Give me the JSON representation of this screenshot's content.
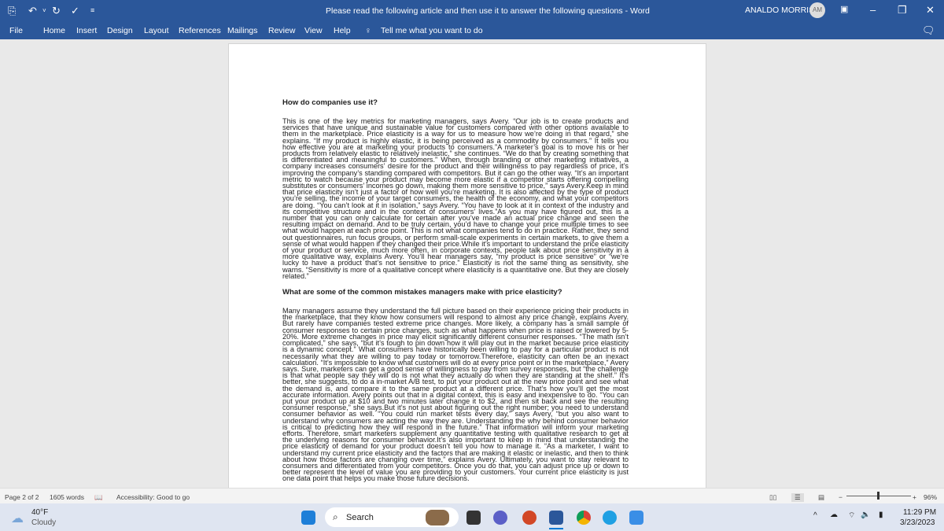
{
  "titlebar": {
    "title": "Please read the following article and then use it to answer the following questions  -  Word",
    "user": "ANALDO MORRIS",
    "avatar": "AM"
  },
  "tabs": [
    "File",
    "Home",
    "Insert",
    "Design",
    "Layout",
    "References",
    "Mailings",
    "Review",
    "View",
    "Help"
  ],
  "tell_me": "Tell me what you want to do",
  "doc": {
    "heading1": "How do companies use it?",
    "para1": "This is one of the key metrics for marketing managers, says Avery. “Our job is to create products and services that have unique and sustainable value for customers compared with other options available to them in the marketplace. Price elasticity is a way for us to measure how we’re doing in that regard,” she explains. “If my product is highly elastic, it is being perceived as a commodity by consumers.” It tells you how effective you are at marketing your products to consumers.”A marketer’s goal is to move his or her products from relatively elastic to relatively inelastic,” she continues. “We do that by creating something that is differentiated and meaningful to customers.” When, through branding or other marketing initiatives, a company increases consumers’ desire for the product and their willingness to pay regardless of price, it’s improving the company’s standing compared with competitors. But it can go the other way. “It’s an important metric to watch because your product may become more elastic if a competitor starts offering compelling substitutes or consumers’ incomes go down, making them more sensitive to price,” says Avery.Keep in mind that price elasticity isn’t just a factor of how well you’re marketing. It is also affected by the type of product you’re selling, the income of your target consumers, the health of the economy, and what your competitors are doing. “You can’t look at it in isolation,” says Avery. “You have to look at it in context of the industry and its competitive structure and in the context of consumers’ lives.”As you may have figured out, this is a number that you can only calculate for certain after you’ve made an actual price change and seen the resulting impact on demand. And to be truly certain, you’d have to change your price multiple times to see what would happen at each price point. This is not what companies tend to do in practice. Rather, they send out questionnaires, run focus groups, or perform small-scale experiments in certain markets, to give them a sense of what would happen if they changed their price.While it’s important to understand the price elasticity of your product or service, much more often, in corporate contexts, people talk about price sensitivity in a more qualitative way, explains Avery. You’ll hear managers say, “my product is price sensitive” or “we’re lucky to have a product that’s not sensitive to price.” Elasticity is not the same thing as sensitivity, she warns. “Sensitivity is more of a qualitative concept where elasticity is a quantitative one. But they are closely related.”",
    "heading2": "What are some of the common mistakes managers make with price elasticity?",
    "para2": "Many managers assume they understand the full picture based on their experience pricing their products in the marketplace, that they know how consumers will respond to almost any price change, explains Avery. But rarely have companies tested extreme price changes. More likely, a company has a small sample of consumer responses to certain price changes, such as what happens when price is raised or lowered by 5-20%. More extreme changes in price may elicit significantly different consumer responses. “The math isn’t complicated,” she says, “but it’s tough to pin down how it will play out in the market because price elasticity is a dynamic concept.” What consumers have historically been willing to pay for a particular product is not necessarily what they are willing to pay today or tomorrow.Therefore, elasticity can often be an inexact calculation. “It’s impossible to know what customers will do at every price point or in the marketplace,” Avery says. Sure, marketers can get a good sense of willingness to pay from survey responses, but “the challenge is that what people say they will do is not what they actually do when they are standing at the shelf.” It’s better, she suggests, to do a in-market A/B test, to put your product out at the new price point and see what the demand is, and compare it to the same product at a different price. That’s how you’ll get the most accurate information. Avery points out that in a digital context, this is easy and inexpensive to do. “You can put your product up at $10 and two minutes later change it to $2, and then sit back and see the resulting consumer response,” she says.But it’s not just about figuring out the right number; you need to understand consumer behavior as well. “You could run market tests every day,” says Avery, “but you also want to understand why consumers are acting the way they are. Understanding the why behind consumer behavior is critical to predicting how they will respond in the future.” That information will inform your marketing efforts. Therefore, smart marketers supplement any quantitative testing with qualitative research to get at the underlying reasons for consumer behavior.It’s also important to keep in mind that understanding the price elasticity of demand for your product doesn’t tell you how to manage it. “As a marketer, I want to understand my current price elasticity and the factors that are making it elastic or inelastic, and then to think about how those factors are changing over time,” explains Avery. Ultimately, you want to stay relevant to consumers and differentiated from your competitors. Once you do that, you can adjust price up or down to better represent the level of value you are providing to your customers. Your current price elasticity is just one data point that helps you make those future decisions."
  },
  "status": {
    "page": "Page 2 of 2",
    "words": "1605 words",
    "accessibility": "Accessibility: Good to go",
    "zoom": "96%",
    "zoom_level_percent": 96
  },
  "taskbar": {
    "temp": "40°F",
    "weather": "Cloudy",
    "search": "Search",
    "time": "11:29 PM",
    "date": "3/23/2023"
  },
  "colors": {
    "word_blue": "#2b579a"
  }
}
